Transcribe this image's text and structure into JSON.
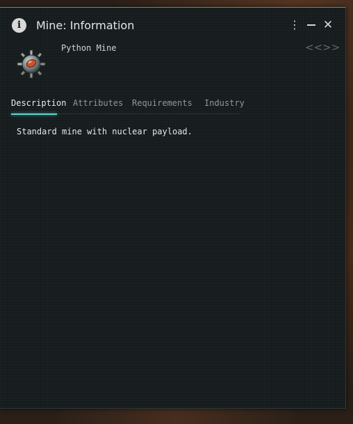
{
  "window": {
    "title": "Mine: Information",
    "info_icon": "info-icon",
    "menu_icon": "⋮",
    "close_icon": "✕"
  },
  "item": {
    "name": "Python Mine",
    "icon": "mine-icon"
  },
  "nav": {
    "back_label": "<<",
    "forward_label": ">>"
  },
  "tabs": [
    {
      "label": "Description",
      "active": true
    },
    {
      "label": "Attributes",
      "active": false
    },
    {
      "label": "Requirements",
      "active": false
    },
    {
      "label": "Industry",
      "active": false
    }
  ],
  "description": "Standard mine with nuclear payload.",
  "colors": {
    "window_bg": "#161c1d",
    "accent": "#5fd6cc",
    "text": "#e2e6e6",
    "muted_text": "#8e9898"
  }
}
